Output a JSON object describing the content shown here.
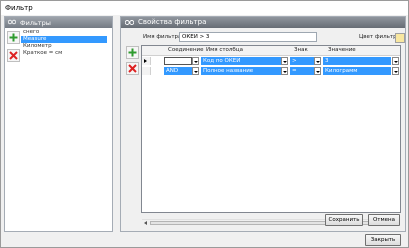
{
  "window": {
    "title": "Фильтр"
  },
  "left_panel": {
    "header": "Фильтры",
    "items": [
      {
        "label": "снего",
        "selected": false
      },
      {
        "label": "Мeasure",
        "selected": true
      },
      {
        "label": "Километр",
        "selected": false
      },
      {
        "label": "Краткое = см",
        "selected": false
      }
    ],
    "add_icon": "plus-icon",
    "delete_icon": "x-icon"
  },
  "right_panel": {
    "header": "Свойства фильтра",
    "filter_name_label": "Имя фильтра:",
    "filter_name_value": "ОКЕИ > 3",
    "color_label": "Цвет фильтра:",
    "color_value": "#f8e7a0",
    "grid": {
      "columns": [
        "Соединение",
        "Имя столбца",
        "Знак",
        "Значение"
      ],
      "rows": [
        {
          "join": "",
          "column": "Код по ОКЕИ",
          "sign": ">",
          "value": "3"
        },
        {
          "join": "AND",
          "column": "Полное название",
          "sign": "=",
          "value": "Килограмм"
        }
      ]
    },
    "save_button": "Сохранить",
    "cancel_button": "Отмена"
  },
  "close_button": "Закрыть",
  "colors": {
    "selection": "#3399ff",
    "header_dark": "#666c74"
  }
}
